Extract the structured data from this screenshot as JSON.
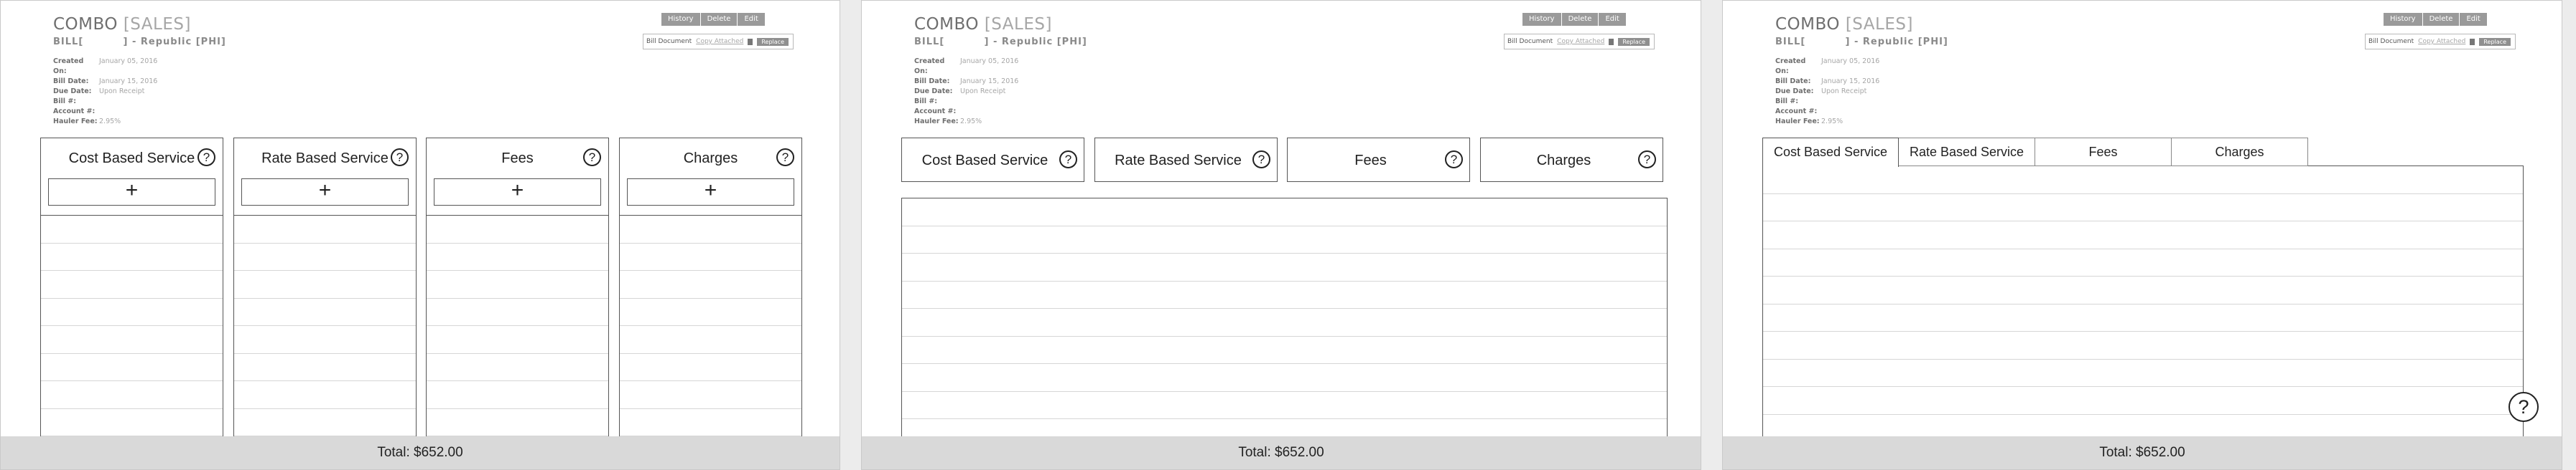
{
  "header": {
    "title_main": "COMBO",
    "title_tag": "[SALES]",
    "subtitle": "BILL[          ] - Republic [PHI]",
    "info": [
      {
        "label": "Created On:",
        "value": "January 05, 2016"
      },
      {
        "label": "Bill Date:",
        "value": "January 15, 2016"
      },
      {
        "label": "Due Date:",
        "value": "Upon Receipt"
      },
      {
        "label": "Bill #:",
        "value": ""
      },
      {
        "label": "Account #:",
        "value": ""
      },
      {
        "label": "Hauler Fee:",
        "value": "2.95%"
      }
    ],
    "buttons": {
      "history": "History",
      "delete": "Delete",
      "edit": "Edit"
    },
    "bill_doc": {
      "label": "Bill Document",
      "link": "Copy Attached",
      "replace": "Replace"
    }
  },
  "services": {
    "cost_based": "Cost Based Service",
    "rate_based": "Rate Based Service",
    "fees": "Fees",
    "charges": "Charges",
    "help_symbol": "?",
    "add_symbol": "+"
  },
  "footer": {
    "total": "Total: $652.00"
  }
}
